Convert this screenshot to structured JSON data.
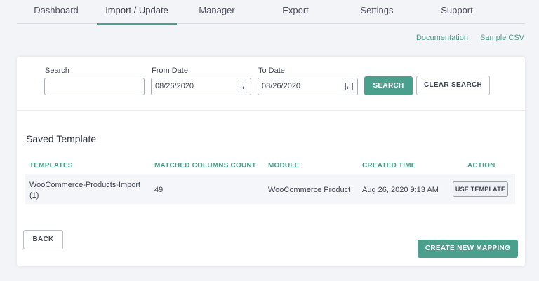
{
  "nav": {
    "tabs": [
      "Dashboard",
      "Import / Update",
      "Manager",
      "Export",
      "Settings",
      "Support"
    ],
    "active": "Import / Update"
  },
  "links": {
    "documentation": "Documentation",
    "sample_csv": "Sample CSV"
  },
  "search": {
    "search_label": "Search",
    "search_value": "",
    "from_label": "From Date",
    "from_value": "08/26/2020",
    "to_label": "To Date",
    "to_value": "08/26/2020",
    "search_button": "SEARCH",
    "clear_button": "CLEAR SEARCH"
  },
  "saved": {
    "title": "Saved Template",
    "columns": [
      "TEMPLATES",
      "MATCHED COLUMNS COUNT",
      "MODULE",
      "CREATED TIME",
      "ACTION"
    ],
    "rows": [
      {
        "template_line1": "WooCommerce-Products-Import",
        "template_line2": "(1)",
        "matched": "49",
        "module": "WooCommerce Product",
        "created": "Aug 26, 2020 9:13 AM",
        "action": "USE TEMPLATE"
      }
    ]
  },
  "footer": {
    "back": "BACK",
    "create": "CREATE NEW MAPPING"
  },
  "colors": {
    "accent": "#4ba08d",
    "background": "#f2f4f8"
  }
}
